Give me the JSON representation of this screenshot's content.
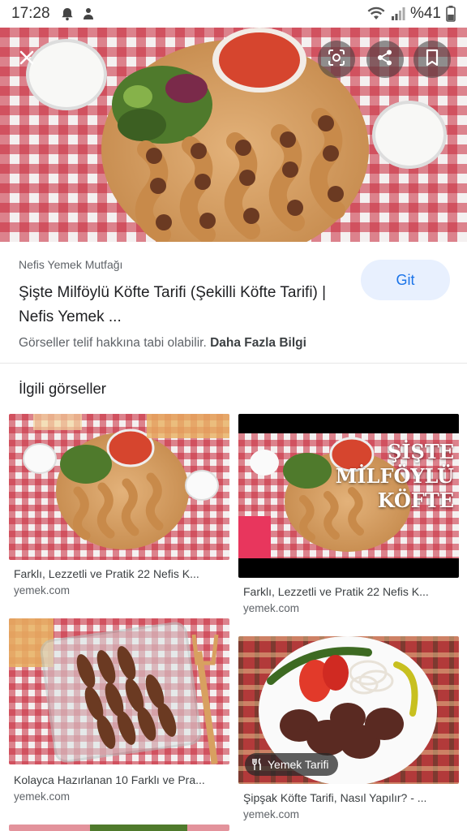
{
  "status_bar": {
    "time": "17:28",
    "battery": "%41"
  },
  "hero": {
    "icons": [
      "close-icon",
      "lens-icon",
      "share-icon",
      "bookmark-icon"
    ]
  },
  "source": {
    "name": "Nefis Yemek Mutfağı",
    "title": "Şişte Milföylü Köfte Tarifi (Şekilli Köfte Tarifi) | Nefis Yemek ...",
    "visit_label": "Git",
    "copyright_text": "Görseller telif hakkına tabi olabilir.",
    "more_info": "Daha Fazla Bilgi"
  },
  "related": {
    "heading": "İlgili görseller",
    "items": [
      {
        "caption": "Farklı, Lezzetli ve Pratik 22 Nefis K...",
        "domain": "yemek.com"
      },
      {
        "caption": "Farklı, Lezzetli ve Pratik 22 Nefis K...",
        "domain": "yemek.com",
        "overlay_text": [
          "ŞİŞTE",
          "MİLFÖYLÜ",
          "KÖFTE"
        ]
      },
      {
        "caption": "Kolayca Hazırlanan 10 Farklı ve Pra...",
        "domain": "yemek.com"
      },
      {
        "caption": "Şipşak Köfte Tarifi, Nasıl Yapılır? - ...",
        "domain": "yemek.com",
        "badge": "Yemek Tarifi"
      }
    ]
  }
}
